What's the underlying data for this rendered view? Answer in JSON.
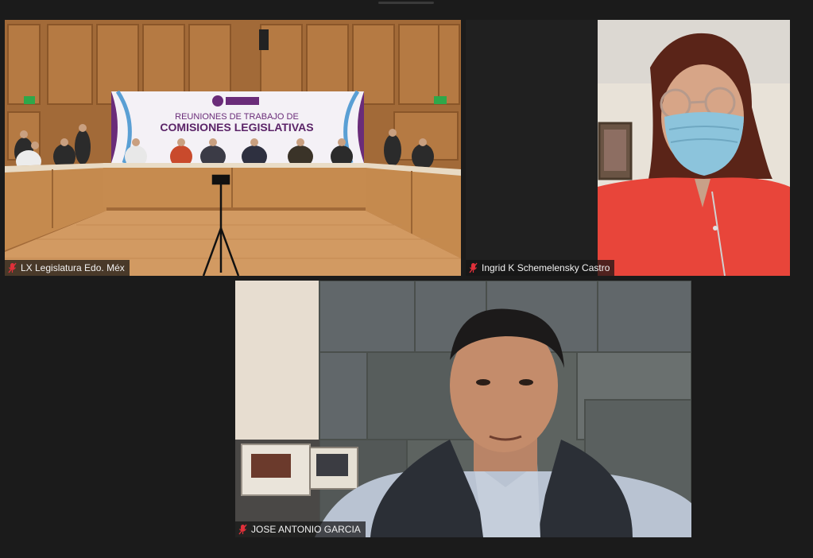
{
  "participants": [
    {
      "name": "LX Legislatura Edo. Méx",
      "muted": true,
      "banner": {
        "line1": "REUNIONES DE TRABAJO DE",
        "line2": "COMISIONES LEGISLATIVAS"
      }
    },
    {
      "name": "Ingrid K Schemelensky Castro",
      "muted": true
    },
    {
      "name": "JOSE ANTONIO GARCIA",
      "muted": true
    }
  ],
  "colors": {
    "background": "#1b1b1b",
    "muted_icon": "#e0303a",
    "wood": "#b9814a",
    "banner_purple": "#6a2c79"
  }
}
